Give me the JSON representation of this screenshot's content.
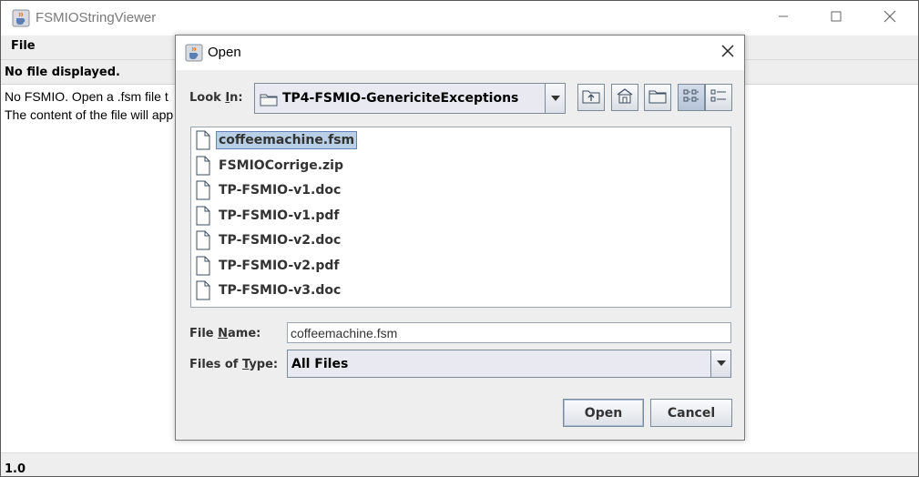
{
  "window": {
    "title": "FSMIOStringViewer",
    "controls": [
      "minimize-icon",
      "maximize-icon",
      "close-icon"
    ]
  },
  "menubar": {
    "file_label": "File"
  },
  "status": {
    "text": "No file displayed."
  },
  "content": {
    "line1": "No FSMIO. Open a .fsm file t",
    "line2": "The content of the file will app"
  },
  "footer": {
    "version": "1.0"
  },
  "dialog": {
    "title": "Open",
    "look_in": {
      "label_pre": "Look ",
      "label_mnemonic": "I",
      "label_post": "n:",
      "value": "TP4-FSMIO-GenericiteExceptions"
    },
    "toolbar": [
      "up-one-level-icon",
      "home-icon",
      "new-folder-icon",
      "list-view-icon",
      "details-view-icon"
    ],
    "files": [
      {
        "name": "coffeemachine.fsm",
        "selected": true
      },
      {
        "name": "FSMIOCorrige.zip",
        "selected": false
      },
      {
        "name": "TP-FSMIO-v1.doc",
        "selected": false
      },
      {
        "name": "TP-FSMIO-v1.pdf",
        "selected": false
      },
      {
        "name": "TP-FSMIO-v2.doc",
        "selected": false
      },
      {
        "name": "TP-FSMIO-v2.pdf",
        "selected": false
      },
      {
        "name": "TP-FSMIO-v3.doc",
        "selected": false
      }
    ],
    "file_name": {
      "label_pre": "File ",
      "label_mnemonic": "N",
      "label_post": "ame:",
      "value": "coffeemachine.fsm"
    },
    "file_type": {
      "label_pre": "Files of ",
      "label_mnemonic": "T",
      "label_post": "ype:",
      "value": "All Files"
    },
    "buttons": {
      "open": "Open",
      "cancel": "Cancel"
    }
  },
  "colors": {
    "selection": "#b8cfe5",
    "selection_border": "#6382bf",
    "panel": "#eeeeee",
    "border": "#7a8a99"
  }
}
